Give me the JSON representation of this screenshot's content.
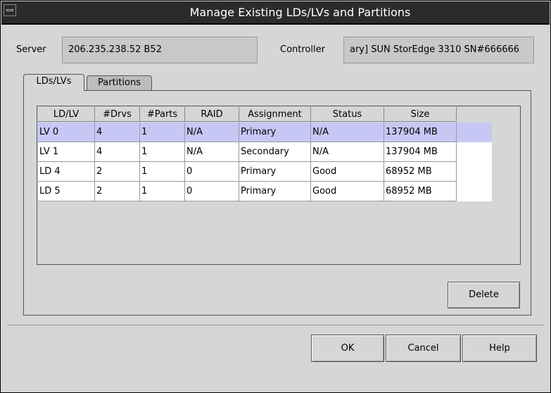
{
  "window": {
    "title": "Manage Existing LDs/LVs and Partitions"
  },
  "server": {
    "label": "Server",
    "value": "206.235.238.52 B52"
  },
  "controller": {
    "label": "Controller",
    "value": "ary] SUN StorEdge 3310 SN#666666"
  },
  "tabs": [
    {
      "label": "LDs/LVs",
      "active": true
    },
    {
      "label": "Partitions",
      "active": false
    }
  ],
  "table": {
    "headers": [
      "LD/LV",
      "#Drvs",
      "#Parts",
      "RAID",
      "Assignment",
      "Status",
      "Size"
    ],
    "rows": [
      [
        "LV 0",
        "4",
        "1",
        "N/A",
        "Primary",
        "N/A",
        "137904 MB"
      ],
      [
        "LV 1",
        "4",
        "1",
        "N/A",
        "Secondary",
        "N/A",
        "137904 MB"
      ],
      [
        "LD 4",
        "2",
        "1",
        "0",
        "Primary",
        "Good",
        "68952 MB"
      ],
      [
        "LD 5",
        "2",
        "1",
        "0",
        "Primary",
        "Good",
        "68952 MB"
      ]
    ],
    "selected_row": 0
  },
  "buttons": {
    "delete": "Delete",
    "ok": "OK",
    "cancel": "Cancel",
    "help": "Help"
  },
  "colors": {
    "selection": "#c7c7f5",
    "titlebar": "#2b2b2b"
  }
}
